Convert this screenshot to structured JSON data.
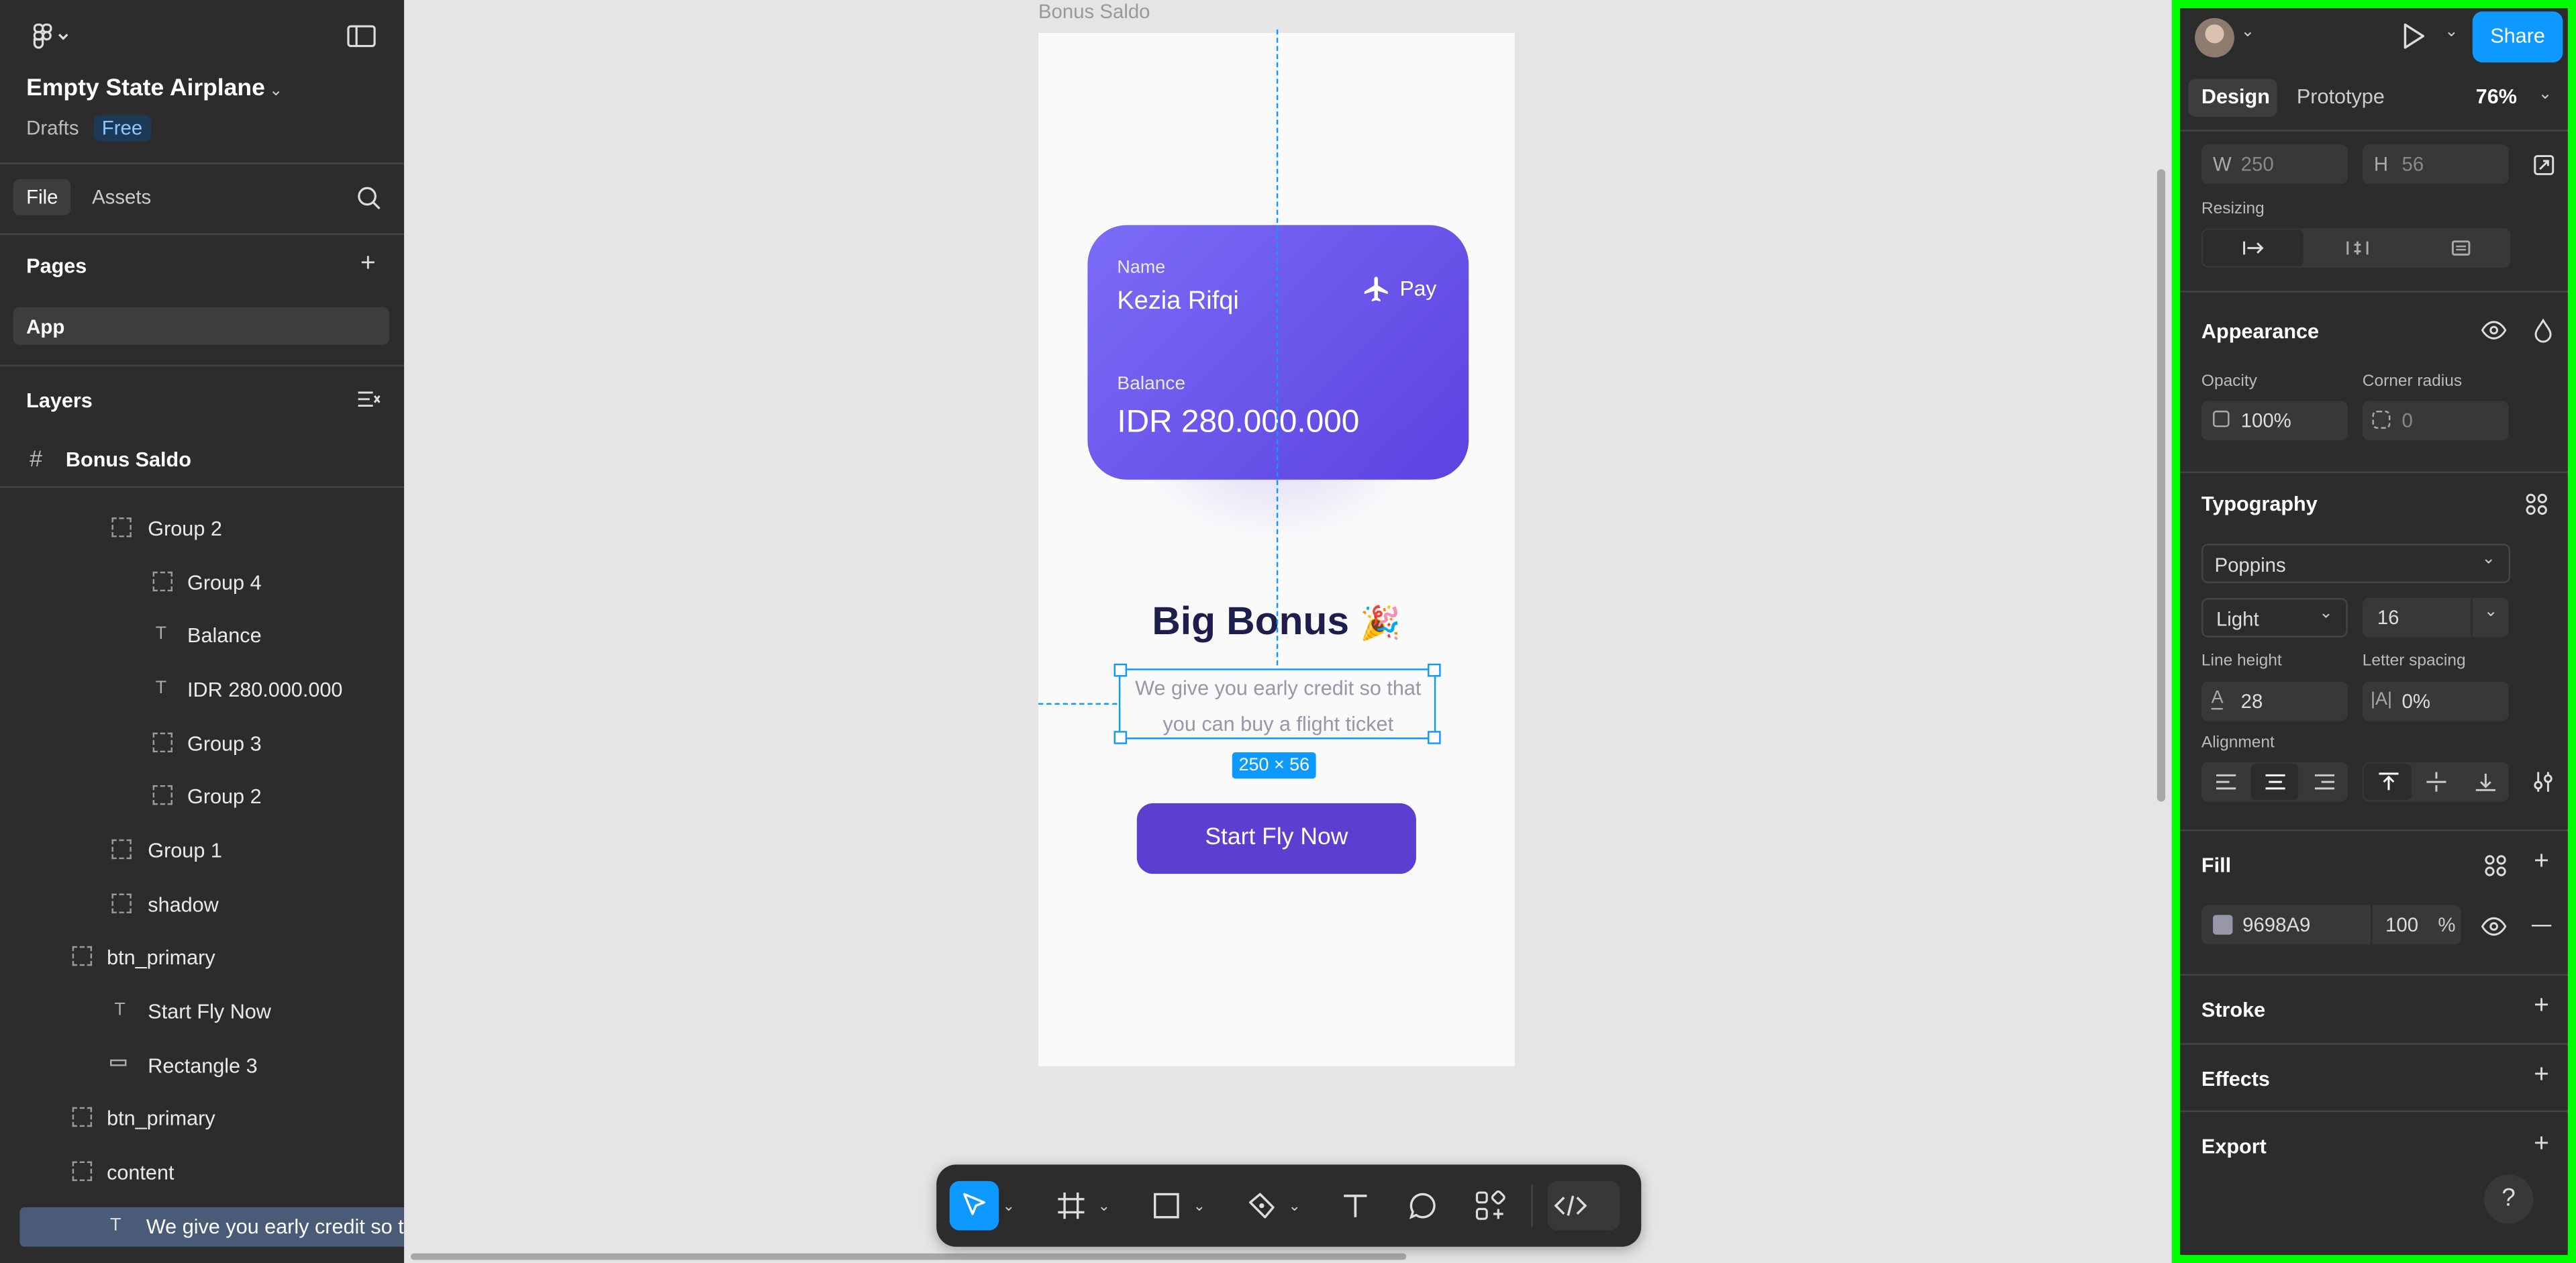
{
  "app": {
    "file_name": "Empty State Airplane",
    "drafts_label": "Drafts",
    "plan_badge": "Free"
  },
  "left_tabs": {
    "file": "File",
    "assets": "Assets"
  },
  "pages": {
    "title": "Pages",
    "items": [
      {
        "label": "App"
      }
    ]
  },
  "layers": {
    "title": "Layers",
    "frame": "Bonus Saldo",
    "items": [
      {
        "label": "Group 2",
        "type": "group"
      },
      {
        "label": "Group 4",
        "type": "group"
      },
      {
        "label": "Balance",
        "type": "text"
      },
      {
        "label": "IDR 280.000.000",
        "type": "text"
      },
      {
        "label": "Group 3",
        "type": "group"
      },
      {
        "label": "Group 2",
        "type": "group"
      },
      {
        "label": "Group 1",
        "type": "group"
      },
      {
        "label": "shadow",
        "type": "group"
      },
      {
        "label": "btn_primary",
        "type": "group"
      },
      {
        "label": "Start Fly Now",
        "type": "text"
      },
      {
        "label": "Rectangle 3",
        "type": "rect"
      },
      {
        "label": "btn_primary",
        "type": "group"
      },
      {
        "label": "content",
        "type": "group"
      },
      {
        "label": "We give you early credit so th",
        "type": "text"
      }
    ]
  },
  "canvas": {
    "frame_label": "Bonus Saldo",
    "card": {
      "name_label": "Name",
      "name_value": "Kezia Rifqi",
      "pay_label": "Pay",
      "balance_label": "Balance",
      "balance_value": "IDR 280.000.000"
    },
    "headline": "Big Bonus",
    "headline_emoji": "🎉",
    "body_text_line1": "We give you early credit so that",
    "body_text_line2": "you can buy a flight ticket",
    "selection_size": "250 × 56",
    "cta_label": "Start Fly Now"
  },
  "right": {
    "share_label": "Share",
    "tabs": {
      "design": "Design",
      "prototype": "Prototype"
    },
    "zoom": "76%",
    "w_label": "W",
    "w_value": "250",
    "h_label": "H",
    "h_value": "56",
    "resizing_label": "Resizing",
    "appearance": {
      "title": "Appearance",
      "opacity_label": "Opacity",
      "opacity_value": "100%",
      "radius_label": "Corner radius",
      "radius_value": "0"
    },
    "typography": {
      "title": "Typography",
      "font_family": "Poppins",
      "font_weight": "Light",
      "font_size": "16",
      "line_height_label": "Line height",
      "line_height_value": "28",
      "letter_spacing_label": "Letter spacing",
      "letter_spacing_value": "0%",
      "alignment_label": "Alignment"
    },
    "fill": {
      "title": "Fill",
      "hex": "9698A9",
      "opacity": "100",
      "percent": "%"
    },
    "stroke_title": "Stroke",
    "effects_title": "Effects",
    "export_title": "Export",
    "help": "?"
  },
  "colors": {
    "accent": "#0d99ff",
    "card_start": "#7b6cf6",
    "card_end": "#5b43e0",
    "cta": "#5b3fd0",
    "headline": "#1f1d4d",
    "fill_swatch": "#9698a9",
    "highlight": "#00ff00"
  }
}
